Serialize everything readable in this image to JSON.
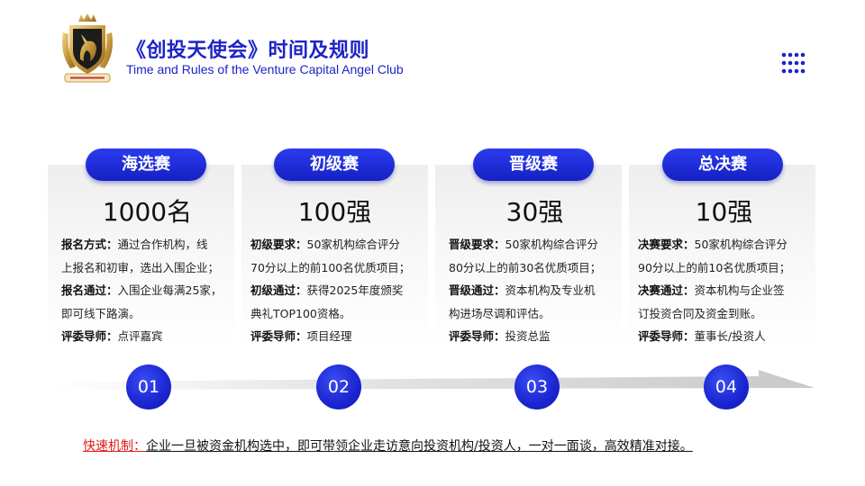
{
  "header": {
    "title_cn": "《创投天使会》时间及规则",
    "title_en": "Time and Rules of the Venture Capital Angel Club"
  },
  "stages": [
    {
      "name": "海选赛",
      "count": "1000名",
      "lines": [
        {
          "label": "报名方式：",
          "text": "通过合作机构，线"
        },
        {
          "label": "",
          "text": "上报名和初审，选出入围企业；"
        },
        {
          "label": "报名通过：",
          "text": "入围企业每满25家，"
        },
        {
          "label": "",
          "text": "即可线下路演。"
        },
        {
          "label": "评委导师：",
          "text": "点评嘉宾"
        }
      ],
      "number": "01"
    },
    {
      "name": "初级赛",
      "count": "100强",
      "lines": [
        {
          "label": "初级要求：",
          "text": "50家机构综合评分"
        },
        {
          "label": "",
          "text": "70分以上的前100名优质项目；"
        },
        {
          "label": "初级通过：",
          "text": "获得2025年度颁奖"
        },
        {
          "label": "",
          "text": "典礼TOP100资格。"
        },
        {
          "label": "评委导师：",
          "text": "项目经理"
        }
      ],
      "number": "02"
    },
    {
      "name": "晋级赛",
      "count": "30强",
      "lines": [
        {
          "label": "晋级要求：",
          "text": "50家机构综合评分"
        },
        {
          "label": "",
          "text": "80分以上的前30名优质项目；"
        },
        {
          "label": "晋级通过：",
          "text": "资本机构及专业机"
        },
        {
          "label": "",
          "text": "构进场尽调和评估。"
        },
        {
          "label": "评委导师：",
          "text": "投资总监"
        }
      ],
      "number": "03"
    },
    {
      "name": "总决赛",
      "count": "10强",
      "lines": [
        {
          "label": "决赛要求：",
          "text": "50家机构综合评分"
        },
        {
          "label": "",
          "text": "90分以上的前10名优质项目；"
        },
        {
          "label": "决赛通过：",
          "text": "资本机构与企业签"
        },
        {
          "label": "",
          "text": "订投资合同及资金到账。"
        },
        {
          "label": "评委导师：",
          "text": "董事长/投资人"
        }
      ],
      "number": "04"
    }
  ],
  "footer": {
    "label": "快速机制：",
    "text": "企业一旦被资金机构选中，即可带领企业走访意向投资机构/投资人，一对一面谈，高效精准对接。"
  },
  "icons": {
    "logo": "unicorn-crest-logo-icon",
    "menu": "dots-grid-icon"
  },
  "colors": {
    "accent": "#1d23c7",
    "highlight": "#e01a1a"
  }
}
